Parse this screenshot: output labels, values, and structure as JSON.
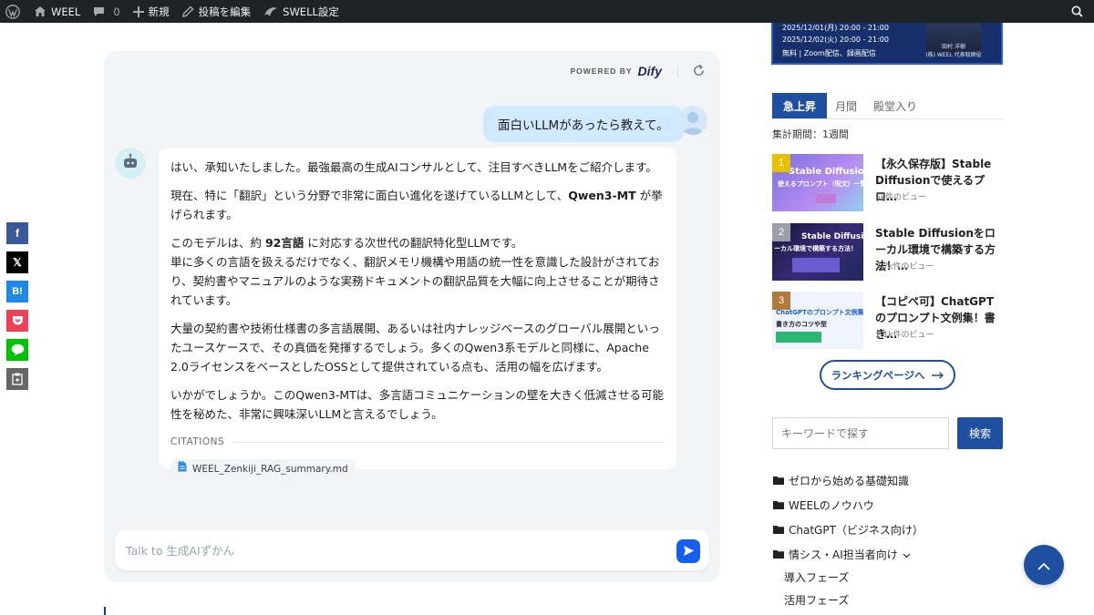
{
  "adminbar": {
    "site_name": "WEEL",
    "comments_count": "0",
    "new_label": "新規",
    "edit_label": "投稿を編集",
    "swell_label": "SWELL設定"
  },
  "banner": {
    "line1": "2025/12/01(月) 20:00 - 21:00",
    "line2": "2025/12/02(火) 20:00 - 21:00",
    "line3": "無料 | Zoom配信、録画配信",
    "name1": "田村 洋樹",
    "name2": "(株) WEEL 代表取締役"
  },
  "chat": {
    "powered_by": "POWERED BY",
    "dify": "Dify",
    "user_message": "面白いLLMがあったら教えて。",
    "answer": {
      "p1": "はい、承知いたしました。最強最高の生成AIコンサルとして、注目すべきLLMをご紹介します。",
      "p2_pre": "現在、特に「翻訳」という分野で非常に面白い進化を遂げているLLMとして、",
      "p2_bold": "Qwen3-MT",
      "p2_post": " が挙げられます。",
      "p3_pre": "このモデルは、約 ",
      "p3_bold": "92言語",
      "p3_post": " に対応する次世代の翻訳特化型LLMです。",
      "p4": "単に多くの言語を扱えるだけでなく、翻訳メモリ機構や用語の統一性を意識した設計がされており、契約書やマニュアルのような実務ドキュメントの翻訳品質を大幅に向上させることが期待されています。",
      "p5": "大量の契約書や技術仕様書の多言語展開、あるいは社内ナレッジベースのグローバル展開といったユースケースで、その真価を発揮するでしょう。多くのQwen3系モデルと同様に、Apache 2.0ライセンスをベースとしたOSSとして提供されている点も、活用の幅を広げます。",
      "p6": "いかがでしょうか。このQwen3-MTは、多言語コミュニケーションの壁を大きく低減させる可能性を秘めた、非常に興味深いLLMと言えるでしょう。"
    },
    "citations_label": "CITATIONS",
    "citation_file": "WEEL_Zenkiji_RAG_summary.md",
    "input_placeholder": "Talk to 生成AIずかん"
  },
  "sidebar": {
    "tabs": [
      "急上昇",
      "月間",
      "殿堂入り"
    ],
    "period": "集計期間：1週間",
    "ranking": [
      {
        "rank": "1",
        "title": "【永久保存版】Stable Diffusionで使えるプロ…",
        "views": "5k件のビュー",
        "thumb1": "Stable Diffusion",
        "thumb2": "使えるプロンプト（呪文）一覧"
      },
      {
        "rank": "2",
        "title": "Stable Diffusionをローカル環境で構築する方法！…",
        "views": "3.7k件のビュー",
        "thumb1": "Stable Diffusion",
        "thumb2": "ーカル環境で構築する方法！"
      },
      {
        "rank": "3",
        "title": "【コピペ可】ChatGPTのプロンプト文例集！書き…",
        "views": "1.1k件のビュー",
        "thumb1": "ChatGPTのプロンプト文例集",
        "thumb2": "書き方のコツや型"
      }
    ],
    "ranking_button": "ランキングページへ",
    "search_placeholder": "キーワードで探す",
    "search_button": "検索",
    "categories": [
      "ゼロから始める基礎知識",
      "WEELのノウハウ",
      "ChatGPT（ビジネス向け）",
      "情シス・AI担当者向け"
    ],
    "subcategories": [
      "導入フェーズ",
      "活用フェーズ"
    ]
  }
}
